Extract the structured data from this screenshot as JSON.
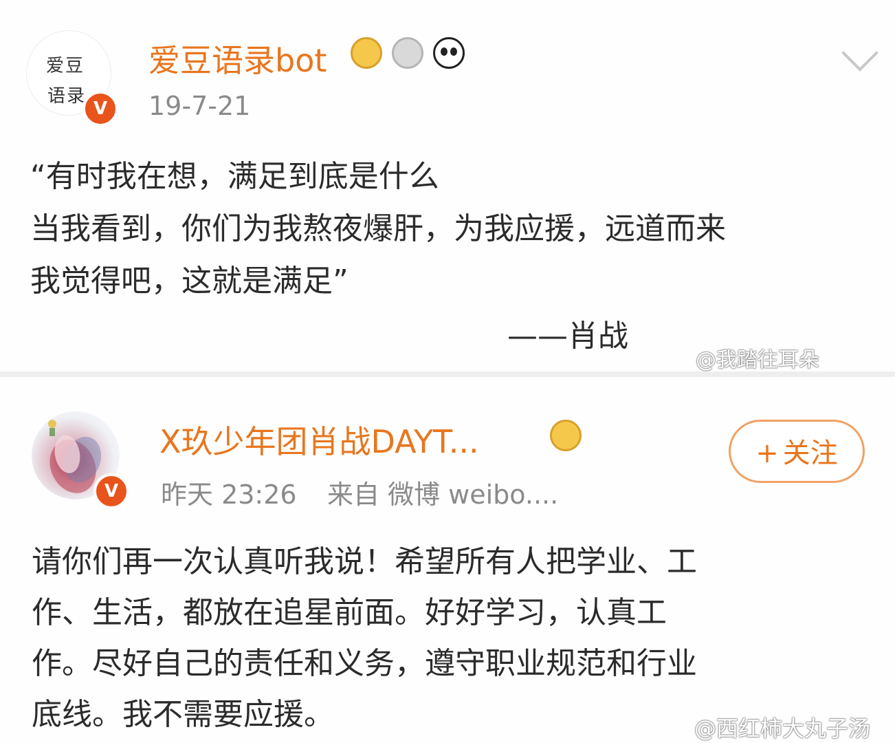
{
  "post1": {
    "avatar_text_line1": "爱豆",
    "avatar_text_line2": "语录",
    "verified_mark": "V",
    "username": "爱豆语录bot",
    "badges": [
      "crown-icon",
      "medal-icon",
      "panda-icon"
    ],
    "date": "19-7-21",
    "body_lines": [
      "“有时我在想，满足到底是什么",
      "当我看到，你们为我熬夜爆肝，为我应援，远道而来",
      "我觉得吧，这就是满足”"
    ],
    "signature": "——肖战",
    "watermark": "@我踏往耳朵"
  },
  "post2": {
    "verified_mark": "V",
    "username": "X玖少年团肖战DAYT...",
    "badges": [
      "crown-icon"
    ],
    "time": "昨天 23:26",
    "source": "来自 微博 weibo....",
    "follow_plus": "+",
    "follow_label": "关注",
    "body_lines": [
      "请你们再一次认真听我说！希望所有人把学业、工",
      "作、生活，都放在追星前面。好好学习，认真工",
      "作。尽好自己的责任和义务，遵守职业规范和行业",
      "底线。我不需要应援。"
    ],
    "watermark": "@西红柿大丸子汤"
  },
  "colors": {
    "username": "#e8761e",
    "verified": "#e8541b",
    "meta": "#8a8a8a",
    "follow_border": "#f1a064"
  }
}
